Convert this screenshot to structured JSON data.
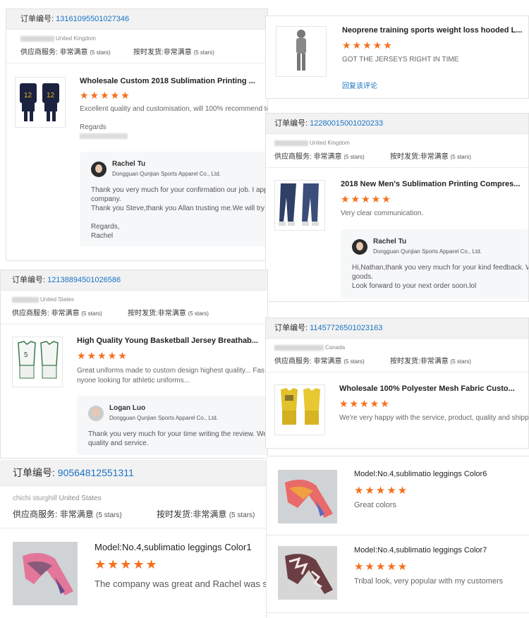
{
  "common": {
    "order_label": "订单编号:",
    "supplier_label": "供应商服务:",
    "ship_label": "按时发货:",
    "very_satisfied": "非常满意",
    "five_stars": "(5 stars)",
    "stars": "★★★★★",
    "reply_link": "回复该评论",
    "company": "Dongguan Qunjian Sports Apparel Co., Ltd."
  },
  "panel1": {
    "order_no": "13161095501027346",
    "buyer_country": "United Kingdom",
    "title": "Wholesale Custom 2018 Sublimation Printing ...",
    "comment": "Excellent quality and customisation, will 100% recommend to",
    "regards": "Regards",
    "reply_name": "Rachel Tu",
    "reply_lines": [
      "Thank you very much for your confirmation our job. I appr",
      "company.",
      "Thank you Steve,thank you Allan trusting me.We will try ou",
      "",
      "Regards,",
      " Rachel"
    ]
  },
  "panel2": {
    "title": "Neoprene training sports weight loss hooded L...",
    "comment": "GOT THE JERSEYS RIGHT IN TIME"
  },
  "panel3": {
    "order_no": "12280015001020233",
    "buyer_country": "United Kingdom",
    "title": "2018 New Men's Sublimation Printing Compres...",
    "comment": "Very clear communication.",
    "reply_name": "Rachel Tu",
    "reply_lines": [
      "Hi,Nathan,thank you very much for your kind feedback. We",
      "goods.",
      "Look forward to your next order soon.lol"
    ]
  },
  "panel4": {
    "order_no": "12138894501026586",
    "buyer_country": "United States",
    "title": "High Quality Young Basketball Jersey Breathab...",
    "comment_lines": [
      "Great uniforms made to custom design highest quality...  Fas",
      "nyone looking for athletic uniforms..."
    ],
    "reply_name": "Logan Luo",
    "reply_lines": [
      "Thank you very much for your time writing the review. We",
      "quality and service."
    ]
  },
  "panel5": {
    "order_no": "11457726501023163",
    "buyer_country": "Canada",
    "title": "Wholesale 100% Polyester Mesh Fabric Custo...",
    "comment": "We're very happy with the service, product, quality and shippin"
  },
  "panel6": {
    "order_no": "90564812551311",
    "buyer_name": "chichi sturghill",
    "buyer_country": "United States",
    "title": "Model:No.4,sublimatio leggings Color1",
    "comment": "The company was great and Rachel was so"
  },
  "panel7": {
    "items": [
      {
        "title": "Model:No.4,sublimatio leggings Color6",
        "comment": "Great colors"
      },
      {
        "title": "Model:No.4,sublimatio leggings Color7",
        "comment": "Tribal look, very popular with my customers"
      }
    ]
  }
}
